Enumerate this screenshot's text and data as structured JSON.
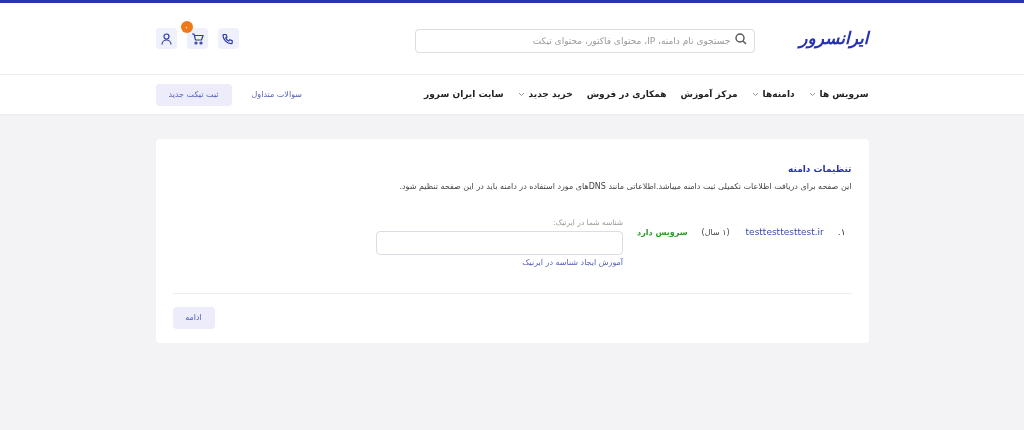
{
  "header": {
    "logo": "ایرانسرور",
    "search": {
      "placeholder": "جستجوی نام دامنه، IP، محتوای فاکتور، محتوای تیکت"
    },
    "cart_badge": "۰"
  },
  "nav": {
    "items": [
      {
        "label": "سرویس ها",
        "dropdown": true
      },
      {
        "label": "دامنه‌ها",
        "dropdown": true
      },
      {
        "label": "مرکز آموزش",
        "dropdown": false
      },
      {
        "label": "همکاری در فروش",
        "dropdown": false
      },
      {
        "label": "خرید جدید",
        "dropdown": true
      },
      {
        "label": "سایت ایران سرور",
        "dropdown": false
      }
    ],
    "faq_link": "سوالات متداول",
    "new_ticket_button": "ثبت تیکت جدید"
  },
  "card": {
    "title": "تنظیمات دامنه",
    "description": "این صفحه برای دریافت اطلاعات تکمیلی ثبت دامنه میباشد.اطلاعاتی مانند DNSهای مورد استفاده در دامنه باید در این صفحه تنظیم شود.",
    "domains": [
      {
        "index": "۱.",
        "domain": "testtesttesttest.ir",
        "period": "(۱ سال)",
        "status": "سرویس دارد",
        "field_label": "شناسه شما در ایرنیک:",
        "help_link": "آموزش ایجاد شناسه در ایرنیک"
      }
    ],
    "continue_button": "ادامه"
  }
}
